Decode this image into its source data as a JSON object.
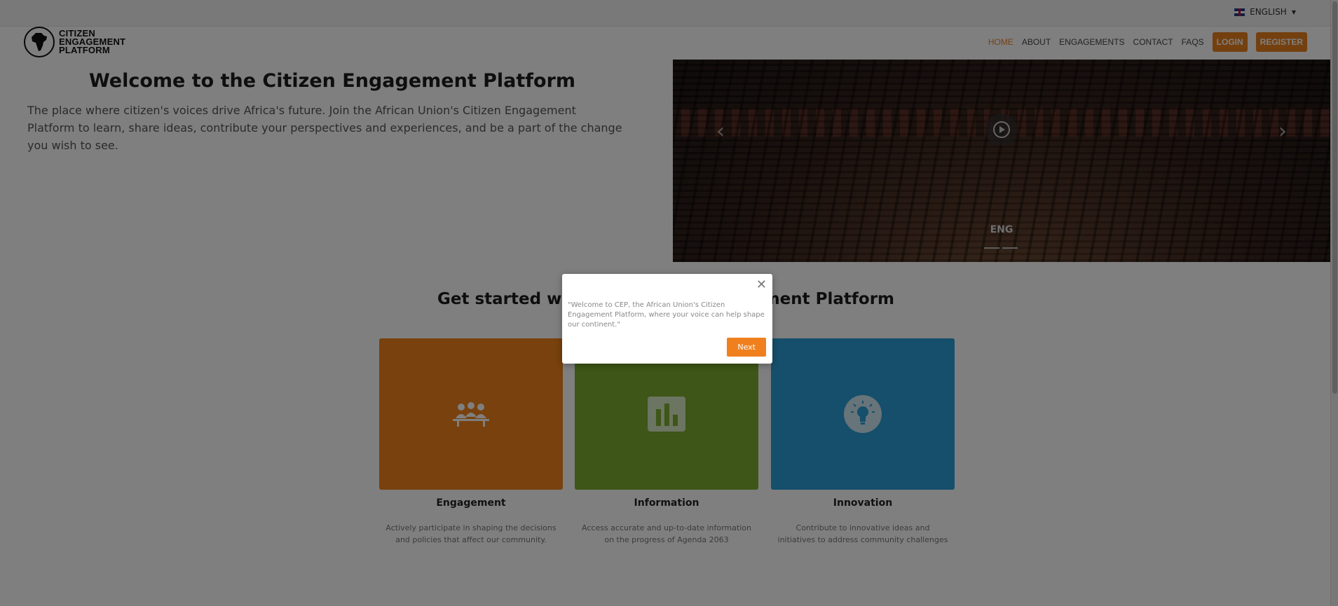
{
  "topbar": {
    "language_label": "ENGLISH"
  },
  "header": {
    "logo_text": [
      "CITIZEN",
      "ENGAGEMENT",
      "PLATFORM"
    ],
    "nav": [
      "HOME",
      "ABOUT",
      "ENGAGEMENTS",
      "CONTACT",
      "FAQS"
    ],
    "login_label": "LOGIN",
    "register_label": "REGISTER"
  },
  "hero": {
    "title": "Welcome to the Citizen Engagement Platform",
    "text": "The place where citizen's voices drive Africa's future. Join the African Union's Citizen Engagement Platform to learn, share ideas, contribute your perspectives and experiences, and be a part of the change you wish to see.",
    "carousel_caption": "ENG",
    "prev_icon": "chevron-left-icon",
    "next_icon": "chevron-right-icon"
  },
  "section": {
    "title": "Get started with the Citizen Engagement Platform",
    "cards": [
      {
        "title": "Engagement",
        "description": "Actively participate in shaping the decisions and policies that affect our community.",
        "color": "#f0821b",
        "icon": "people-icon"
      },
      {
        "title": "Information",
        "description": "Access accurate and up-to-date information on the progress of Agenda 2063",
        "color": "#7cac2e",
        "icon": "bar-chart-icon"
      },
      {
        "title": "Innovation",
        "description": "Contribute to innovative ideas and initiatives to address community challenges",
        "color": "#2a9fd6",
        "icon": "lightbulb-icon"
      }
    ]
  },
  "modal": {
    "text": "\"Welcome to CEP, the African Union's Citizen Engagement Platform, where your voice can help shape our continent.\"",
    "next_label": "Next",
    "close_icon": "close-icon"
  },
  "colors": {
    "accent": "#e8801e",
    "active_nav": "#e8822a"
  }
}
